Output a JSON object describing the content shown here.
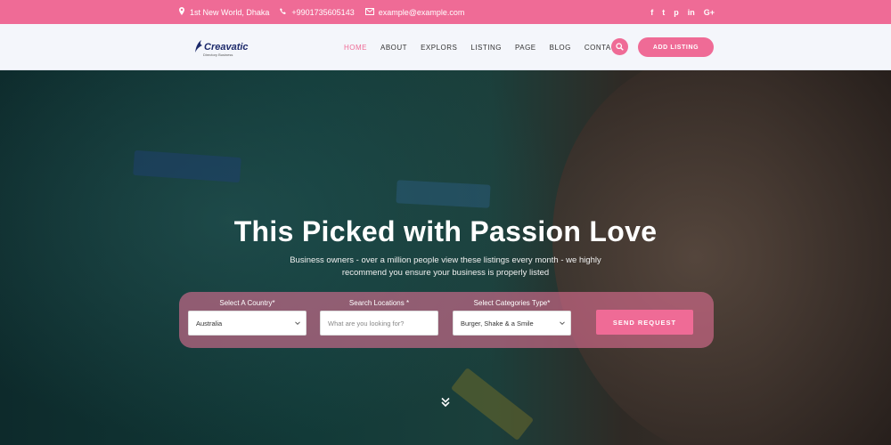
{
  "topbar": {
    "address": "1st New World, Dhaka",
    "phone": "+9901735605143",
    "email": "example@example.com",
    "social": [
      "f",
      "t",
      "p",
      "in",
      "G+"
    ]
  },
  "nav": {
    "logo_text": "Creavatic",
    "logo_tagline": "Directory Business",
    "items": [
      "HOME",
      "ABOUT",
      "EXPLORS",
      "LISTING",
      "PAGE",
      "BLOG",
      "CONTACT"
    ],
    "add_listing": "ADD LISTING"
  },
  "hero": {
    "title": "This Picked with Passion Love",
    "subtitle_line1": "Business owners - over a million people view these listings every month - we highly",
    "subtitle_line2": "recommend you ensure your business is properly listed"
  },
  "search": {
    "country_label": "Select A Country*",
    "country_value": "Australia",
    "location_label": "Search Locations *",
    "location_placeholder": "What are you looking for?",
    "category_label": "Select Categories Type*",
    "category_value": "Burger, Shake & a Smile",
    "send_label": "SEND REQUEST"
  },
  "colors": {
    "accent": "#ef6b96",
    "navy": "#1d2a6b"
  }
}
